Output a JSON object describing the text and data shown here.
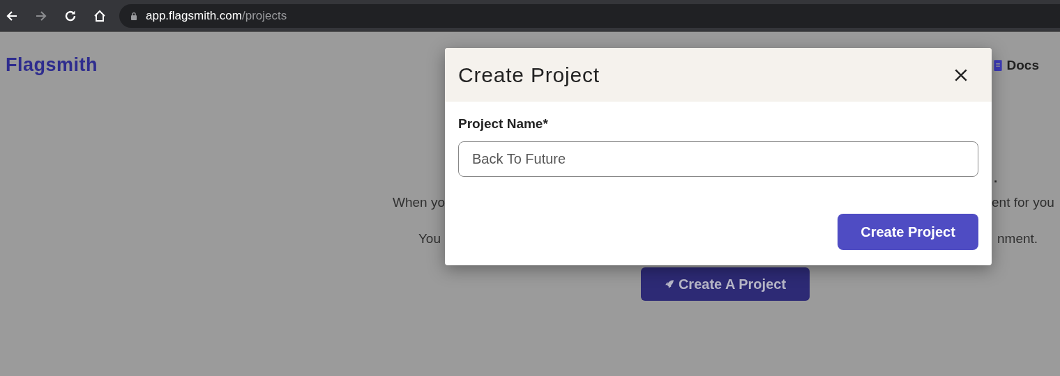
{
  "browser": {
    "url_host": "app.flagsmith.com",
    "url_path": "/projects"
  },
  "header": {
    "logo": "Flagsmith",
    "docs_link": "Docs"
  },
  "background": {
    "heading_end": ".",
    "lines": [
      {
        "left": "When yo",
        "right": "ent for you"
      },
      {
        "left": "You",
        "right": "nment."
      }
    ],
    "create_button": "Create A Project"
  },
  "modal": {
    "title": "Create Project",
    "field_label": "Project Name*",
    "field_value": "Back To Future",
    "submit": "Create Project"
  }
}
